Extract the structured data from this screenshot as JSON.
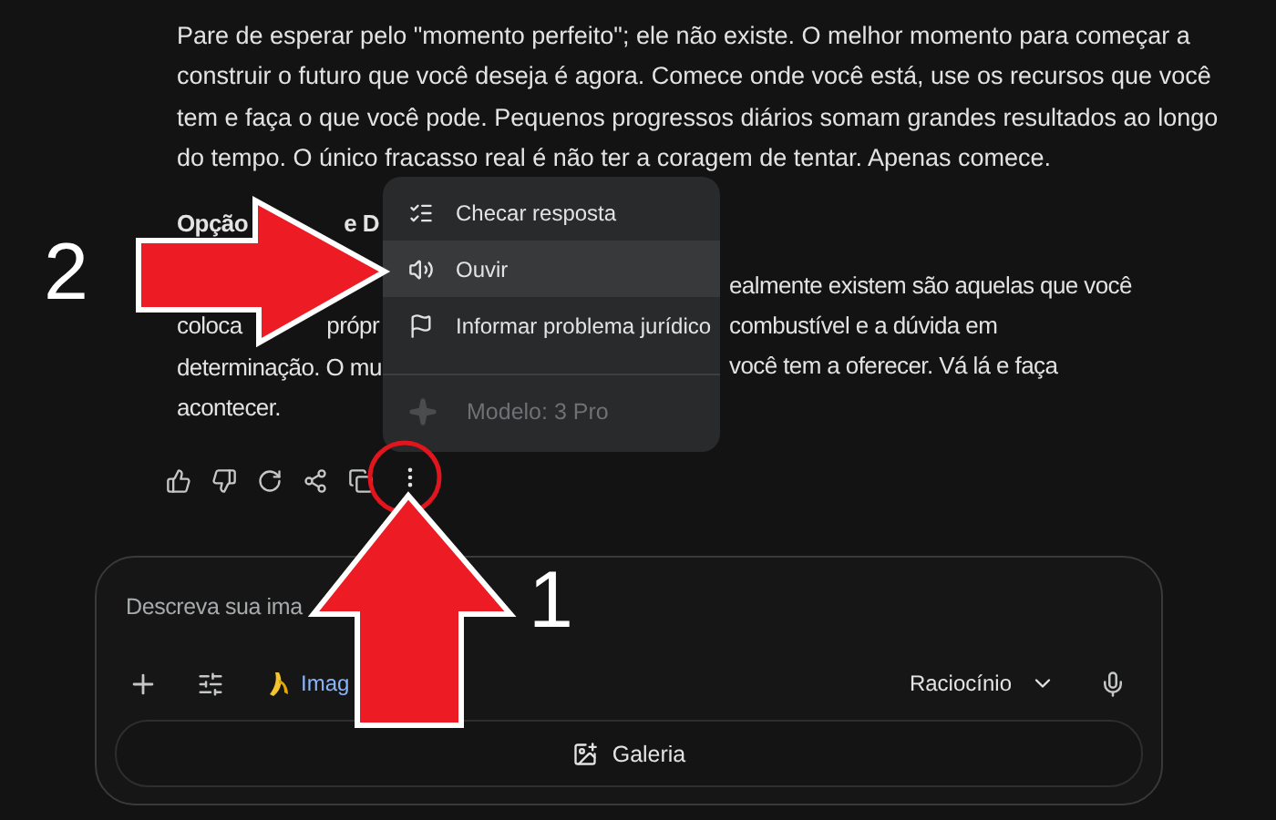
{
  "response": {
    "paragraph": "Pare de esperar pelo \"momento perfeito\"; ele não existe. O melhor momento para começar a construir o futuro que você deseja é agora. Comece onde você está, use os recursos que você tem e faça o que você pode. Pequenos progressos diários somam grandes resultados ao longo do tempo. O único fracasso real é não ter a coragem de tentar. Apenas comece.",
    "lines": [
      {
        "kind": "heading",
        "left": [
          "Opção",
          "e D"
        ]
      },
      {
        "kind": "body",
        "right": "ealmente existem são aquelas que você"
      },
      {
        "kind": "body",
        "left": [
          "coloca",
          "própr"
        ],
        "right": "combustível e a dúvida em"
      },
      {
        "kind": "body",
        "left": [
          "determinação. O mu"
        ],
        "right": "você tem a oferecer. Vá lá e faça"
      },
      {
        "kind": "body",
        "left": [
          "acontecer."
        ]
      }
    ]
  },
  "menu": {
    "items": [
      {
        "label": "Checar resposta",
        "selected": false
      },
      {
        "label": "Ouvir",
        "selected": true
      },
      {
        "label": "Informar problema jurídico",
        "selected": false
      }
    ],
    "footer": "Modelo: 3 Pro"
  },
  "composer": {
    "placeholder": "Descreva sua ima",
    "tool_label": "Imag",
    "mode": "Raciocínio",
    "gallery": "Galeria"
  },
  "annotations": [
    {
      "label": "2"
    },
    {
      "label": "1"
    }
  ]
}
